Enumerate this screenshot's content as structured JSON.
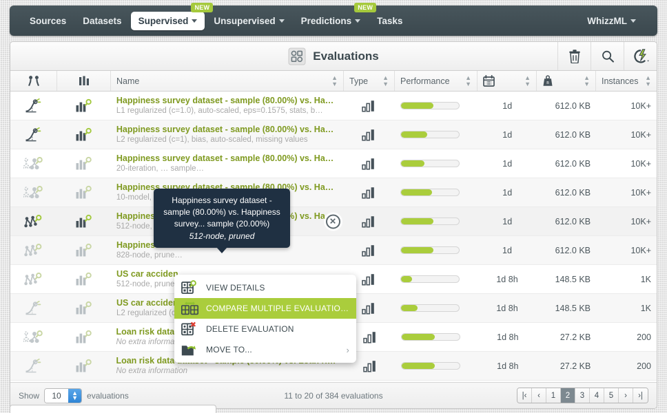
{
  "nav": {
    "items": [
      {
        "label": "Sources",
        "caret": false,
        "active": false,
        "badge": null
      },
      {
        "label": "Datasets",
        "caret": false,
        "active": false,
        "badge": null
      },
      {
        "label": "Supervised",
        "caret": true,
        "active": true,
        "badge": "NEW"
      },
      {
        "label": "Unsupervised",
        "caret": true,
        "active": false,
        "badge": null
      },
      {
        "label": "Predictions",
        "caret": true,
        "active": false,
        "badge": "NEW"
      },
      {
        "label": "Tasks",
        "caret": false,
        "active": false,
        "badge": null
      }
    ],
    "right": {
      "label": "WhizzML",
      "caret": true
    }
  },
  "toolbar": {
    "title": "Evaluations",
    "title_icon": "evaluation-grid-icon",
    "actions": [
      {
        "name": "delete-icon",
        "label": "Delete"
      },
      {
        "name": "search-icon",
        "label": "Search"
      },
      {
        "name": "whizzml-bolt-icon",
        "label": "WhizzML actions"
      }
    ]
  },
  "table": {
    "headers": {
      "model_icon": "",
      "eval_icon": "",
      "name": "Name",
      "type": "Type",
      "performance": "Performance",
      "date": "",
      "size": "",
      "instances": "Instances"
    },
    "header_icons": {
      "model_icon": "model-type-icon",
      "eval_icon": "histogram-icon",
      "date": "calendar-icon",
      "size": "weight-icon"
    },
    "rows": [
      {
        "model_icon": "logistic-regression-icon",
        "eval_icon": "histogram-icon",
        "name": "Happiness survey dataset - sample (80.00%) vs. Hap…",
        "sub": "L1 regularized (c=1.0), auto-scaled, eps=0.1575, stats, b…",
        "sub_italic": false,
        "type_icon": "bar-chart-icon",
        "performance": 56,
        "date": "1d",
        "size": "612.0 KB",
        "instances": "10K+",
        "dim": false,
        "hovered": false
      },
      {
        "model_icon": "logistic-regression-icon",
        "eval_icon": "histogram-icon",
        "name": "Happiness survey dataset - sample (80.00%) vs. Hap…",
        "sub": "L2 regularized (c=1), bias, auto-scaled, missing values",
        "sub_italic": false,
        "type_icon": "bar-chart-icon",
        "performance": 45,
        "date": "1d",
        "size": "612.0 KB",
        "instances": "10K+",
        "dim": false,
        "hovered": false
      },
      {
        "model_icon": "ensemble-icon",
        "eval_icon": "histogram-icon",
        "name": "Happiness survey dataset - sample (80.00%) vs. Hap…",
        "sub": "20-iteration, … sample…",
        "sub_italic": false,
        "type_icon": "bar-chart-icon",
        "performance": 40,
        "date": "1d",
        "size": "612.0 KB",
        "instances": "10K+",
        "dim": true,
        "hovered": false
      },
      {
        "model_icon": "ensemble-icon",
        "eval_icon": "histogram-icon",
        "name": "Happiness survey dataset - sample (80.00%) vs. Hap…",
        "sub": "10-model, …",
        "sub_italic": false,
        "type_icon": "bar-chart-icon",
        "performance": 53,
        "date": "1d",
        "size": "612.0 KB",
        "instances": "10K+",
        "dim": true,
        "hovered": false
      },
      {
        "model_icon": "decision-tree-icon",
        "eval_icon": "histogram-icon",
        "name": "Happiness survey dataset - sample (80.00%) vs. Hap…",
        "sub": "512-node, pruned",
        "sub_italic": false,
        "type_icon": "bar-chart-icon",
        "performance": 56,
        "date": "1d",
        "size": "612.0 KB",
        "instances": "10K+",
        "dim": false,
        "hovered": true
      },
      {
        "model_icon": "decision-tree-icon",
        "eval_icon": "histogram-icon",
        "name": "Happiness surv…",
        "sub": "828-node, prune…",
        "sub_italic": false,
        "type_icon": "bar-chart-icon",
        "performance": 56,
        "date": "1d",
        "size": "612.0 KB",
        "instances": "10K+",
        "dim": true,
        "hovered": false
      },
      {
        "model_icon": "decision-tree-icon",
        "eval_icon": "histogram-icon",
        "name": "US car acciden…",
        "sub": "512-node, prune…",
        "sub_italic": false,
        "type_icon": "bar-chart-icon",
        "performance": 19,
        "date": "1d 8h",
        "size": "148.5 KB",
        "instances": "1K",
        "dim": true,
        "hovered": false
      },
      {
        "model_icon": "logistic-regression-icon",
        "eval_icon": "histogram-icon",
        "name": "US car acciden…",
        "sub": "L2 regularized (c…",
        "sub_italic": false,
        "type_icon": "bar-chart-icon",
        "performance": 28,
        "date": "1d 8h",
        "size": "148.5 KB",
        "instances": "1K",
        "dim": true,
        "hovered": false
      },
      {
        "model_icon": "ensemble-icon",
        "eval_icon": "histogram-icon",
        "name": "Loan risk data dataset - sample (80.00%) vs. Loan ris…",
        "sub": "No extra information",
        "sub_italic": true,
        "type_icon": "bar-chart-icon",
        "performance": 57,
        "date": "1d 8h",
        "size": "27.2 KB",
        "instances": "200",
        "dim": true,
        "hovered": false
      },
      {
        "model_icon": "logistic-regression-icon",
        "eval_icon": "histogram-icon",
        "name": "Loan risk data dataset - sample (80.00%) vs. Loan ris…",
        "sub": "No extra information",
        "sub_italic": true,
        "type_icon": "bar-chart-icon",
        "performance": 56,
        "date": "1d 8h",
        "size": "27.2 KB",
        "instances": "200",
        "dim": true,
        "hovered": false
      }
    ]
  },
  "tooltip": {
    "line1": "Happiness survey dataset -",
    "line2": "sample (80.00%) vs. Happiness",
    "line3": "survey... sample (20.00%)",
    "sub": "512-node, pruned"
  },
  "context_menu": {
    "items": [
      {
        "label": "VIEW DETAILS",
        "icon": "view-details-icon",
        "selected": false,
        "submenu": false
      },
      {
        "label": "COMPARE MULTIPLE EVALUATIO…",
        "icon": "compare-evaluations-icon",
        "selected": true,
        "submenu": false
      },
      {
        "label": "DELETE EVALUATION",
        "icon": "delete-evaluation-icon",
        "selected": false,
        "submenu": false
      },
      {
        "label": "MOVE TO...",
        "icon": "move-to-folder-icon",
        "selected": false,
        "submenu": true
      }
    ],
    "submenu_arrow": "›"
  },
  "footer": {
    "show_label": "Show",
    "page_size": "10",
    "unit_label": "evaluations",
    "summary": "11 to 20 of 384 evaluations",
    "pager": [
      {
        "label": "|‹",
        "name": "first-page-button",
        "current": false
      },
      {
        "label": "‹",
        "name": "prev-page-button",
        "current": false
      },
      {
        "label": "1",
        "name": "page-1-button",
        "current": false
      },
      {
        "label": "2",
        "name": "page-2-button",
        "current": true
      },
      {
        "label": "3",
        "name": "page-3-button",
        "current": false
      },
      {
        "label": "4",
        "name": "page-4-button",
        "current": false
      },
      {
        "label": "5",
        "name": "page-5-button",
        "current": false
      },
      {
        "label": "›",
        "name": "next-page-button",
        "current": false
      },
      {
        "label": "›|",
        "name": "last-page-button",
        "current": false
      }
    ]
  },
  "colors": {
    "accent_green": "#aacd3c",
    "name_green": "#7f9a20",
    "nav_dark": "#3b484e",
    "tooltip_bg": "#1f3042",
    "pager_current": "#7d8990"
  }
}
